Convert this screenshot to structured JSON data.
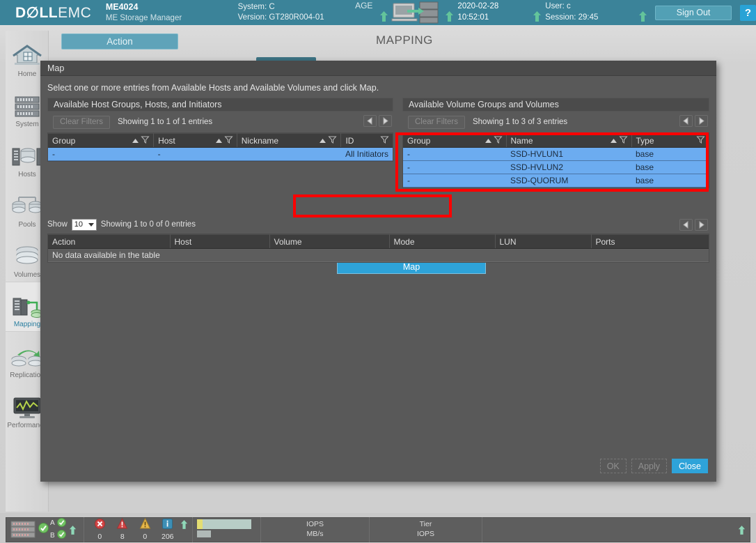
{
  "header": {
    "brand_dell": "D∅LL",
    "brand_emc": "EMC",
    "system_model": "ME4024",
    "system_product": "ME Storage Manager",
    "system_label": "System: C",
    "system_age": "AGE",
    "version_label": "Version: GT280R004-01",
    "date": "2020-02-28",
    "time": "10:52:01",
    "user": "User: c",
    "session": "Session: 29:45",
    "sign_out": "Sign Out",
    "help": "?",
    "accent_color": "#3b8399",
    "button_color": "#29a3d6"
  },
  "sidebar": {
    "items": [
      {
        "label": "Home",
        "icon": "home-icon",
        "active": false
      },
      {
        "label": "System",
        "icon": "system-icon",
        "active": false
      },
      {
        "label": "Hosts",
        "icon": "hosts-icon",
        "active": false
      },
      {
        "label": "Pools",
        "icon": "pools-icon",
        "active": false
      },
      {
        "label": "Volumes",
        "icon": "volumes-icon",
        "active": false
      },
      {
        "label": "Mapping",
        "icon": "mapping-icon",
        "active": true
      },
      {
        "label": "Replication",
        "icon": "replication-icon",
        "active": false
      },
      {
        "label": "Performance",
        "icon": "performance-icon",
        "active": false
      }
    ]
  },
  "page": {
    "action_button": "Action",
    "title": "MAPPING"
  },
  "dialog": {
    "title": "Map",
    "instruction": "Select one or more entries from Available Hosts and Available Volumes and click Map.",
    "hosts_panel": {
      "header": "Available Host Groups, Hosts, and Initiators",
      "clear_filters": "Clear Filters",
      "showing": "Showing 1 to 1 of 1 entries",
      "columns": [
        "Group",
        "Host",
        "Nickname",
        "ID"
      ],
      "rows": [
        {
          "group": "-",
          "host": "-",
          "nickname": "",
          "id": "All Initiators",
          "selected": true
        }
      ]
    },
    "volumes_panel": {
      "header": "Available Volume Groups and Volumes",
      "clear_filters": "Clear Filters",
      "showing": "Showing 1 to 3 of 3 entries",
      "columns": [
        "Group",
        "Name",
        "Type"
      ],
      "rows": [
        {
          "group": "-",
          "name": "SSD-HVLUN1",
          "type": "base",
          "selected": true
        },
        {
          "group": "-",
          "name": "SSD-HVLUN2",
          "type": "base",
          "selected": true
        },
        {
          "group": "-",
          "name": "SSD-QUORUM",
          "type": "base",
          "selected": true
        }
      ]
    },
    "map_button": "Map",
    "lower_table": {
      "show_label": "Show",
      "show_value": "10",
      "showing": "Showing 1 to 0 of 0 entries",
      "columns": [
        "Action",
        "Host",
        "Volume",
        "Mode",
        "LUN",
        "Ports"
      ],
      "empty_message": "No data available in the table"
    },
    "footer": {
      "ok": "OK",
      "apply": "Apply",
      "close": "Close"
    }
  },
  "annotations": {
    "color": "#ff0000",
    "boxes": [
      "volumes-table-highlight",
      "map-button-highlight"
    ]
  },
  "statusbar": {
    "enclosure_a": "A",
    "enclosure_b": "B",
    "events": [
      {
        "icon": "error-icon",
        "count": "0"
      },
      {
        "icon": "critical-icon",
        "count": "8"
      },
      {
        "icon": "warning-icon",
        "count": "0"
      },
      {
        "icon": "information-icon",
        "count": "206"
      }
    ],
    "iops_label_line1": "IOPS",
    "iops_label_line2": "MB/s",
    "tier_label_line1": "Tier",
    "tier_label_line2": "IOPS"
  }
}
